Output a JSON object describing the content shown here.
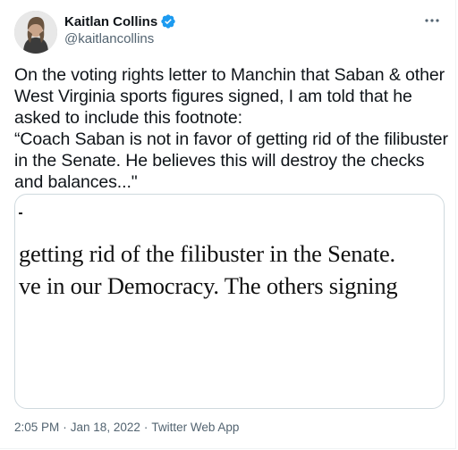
{
  "author": {
    "name": "Kaitlan Collins",
    "handle": "@kaitlancollins",
    "verified": true,
    "avatar_icon": "user-avatar"
  },
  "menu_icon": "more-horizontal-icon",
  "tweet": {
    "lines": [
      "On the voting rights letter to Manchin that Saban & other West Virginia sports figures signed, I am told that he asked to include this footnote:",
      "“Coach Saban is not in favor of getting rid of the filibuster in the Senate. He believes this will destroy the checks and balances...\""
    ]
  },
  "media": {
    "lines": [
      "getting rid of the filibuster in the Senate.",
      "ve in our Democracy.  The others signing"
    ]
  },
  "meta": {
    "time": "2:05 PM",
    "date": "Jan 18, 2022",
    "source": "Twitter Web App",
    "separator": "·"
  },
  "colors": {
    "text": "#0f1419",
    "secondary": "#536471",
    "verified": "#1d9bf0",
    "border": "#cfd9de"
  }
}
